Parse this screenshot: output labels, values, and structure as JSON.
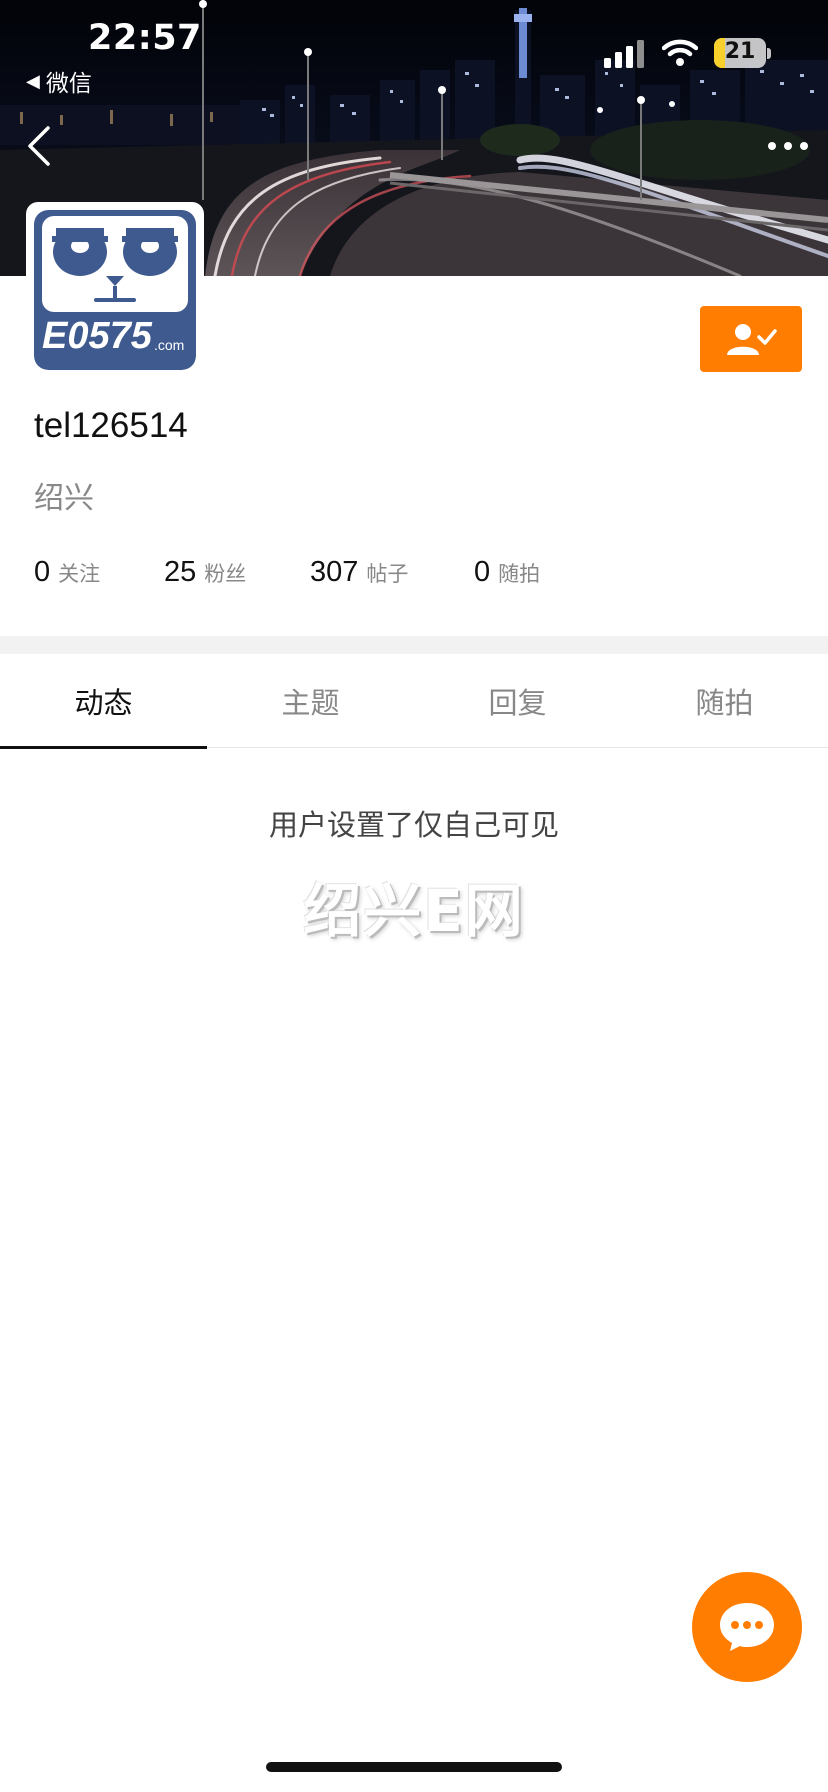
{
  "status_bar": {
    "time": "22:57",
    "back_app_label": "微信",
    "battery_level": "21",
    "icons": [
      "signal-icon",
      "wifi-icon",
      "battery-icon"
    ]
  },
  "nav": {
    "icons": [
      "back-arrow-icon",
      "more-icon"
    ]
  },
  "cover": {
    "description_icon": "city-night-highway-photo"
  },
  "profile": {
    "username": "tel126514",
    "location": "绍兴",
    "avatar_icon": "panda-logo-icon",
    "avatar_text": "E0575",
    "avatar_text_suffix": ".com",
    "follow_icon": "user-check-icon"
  },
  "stats": [
    {
      "value": "0",
      "label": "关注"
    },
    {
      "value": "25",
      "label": "粉丝"
    },
    {
      "value": "307",
      "label": "帖子"
    },
    {
      "value": "0",
      "label": "随拍"
    }
  ],
  "tabs": [
    {
      "label": "动态",
      "active": true
    },
    {
      "label": "主题",
      "active": false
    },
    {
      "label": "回复",
      "active": false
    },
    {
      "label": "随拍",
      "active": false
    }
  ],
  "content": {
    "empty_message": "用户设置了仅自己可见",
    "watermark": "绍兴E网"
  },
  "fab": {
    "icon": "chat-bubble-icon"
  },
  "colors": {
    "accent": "#ff7d00",
    "text_primary": "#111111",
    "text_secondary": "#888888",
    "divider": "#f2f2f2",
    "avatar_blue": "#3e5a8e"
  }
}
